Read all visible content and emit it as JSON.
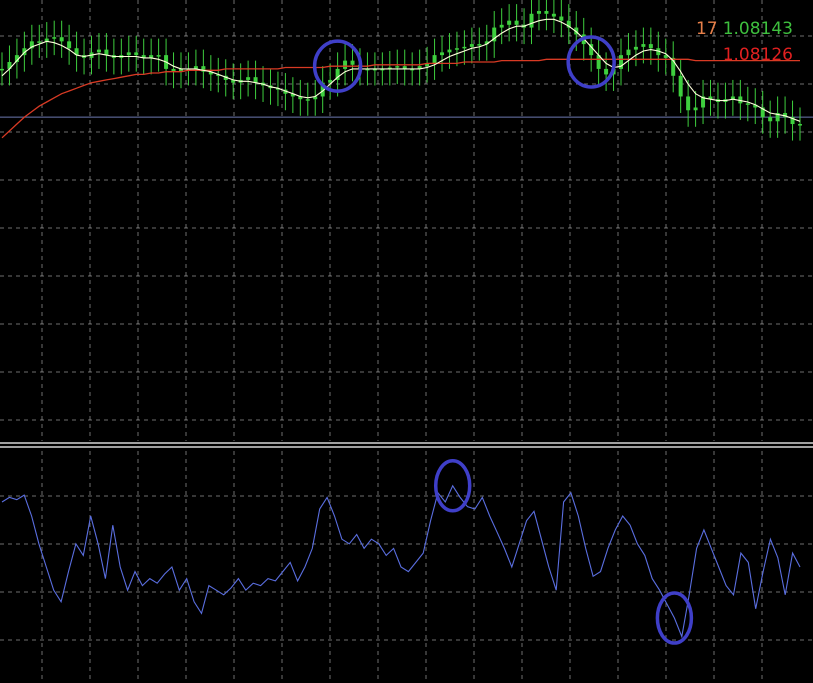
{
  "price_labels": {
    "period": "17",
    "fast_ma_value": "1.08143",
    "slow_ma_value": "1.08126"
  },
  "colors": {
    "background": "#000000",
    "grid": "#c8c8c8",
    "candle": "#3ecf3e",
    "fast_ma": "#ffffdc",
    "slow_ma": "#d83a24",
    "bid_line": "#6c78b0",
    "oscillator": "#5a6ee0",
    "highlight_circle": "#3f3fc8",
    "period_label": "#e8804a",
    "fast_label": "#3ec03e",
    "slow_label": "#e02020",
    "separator": "#ffffff"
  },
  "chart_data": [
    {
      "type": "line",
      "panel": "price",
      "grid": true,
      "series": [
        {
          "role": "candles",
          "values": [
            1.0812,
            1.08125,
            1.0813,
            1.08135,
            1.0814,
            1.0814,
            1.08142,
            1.08143,
            1.0814,
            1.08135,
            1.0813,
            1.08128,
            1.08132,
            1.08134,
            1.0813,
            1.08128,
            1.0813,
            1.08132,
            1.0813,
            1.08128,
            1.0813,
            1.0813,
            1.0812,
            1.08118,
            1.0812,
            1.0812,
            1.08122,
            1.08118,
            1.08116,
            1.08115,
            1.08112,
            1.0811,
            1.08112,
            1.08114,
            1.0811,
            1.08108,
            1.08106,
            1.08105,
            1.08102,
            1.081,
            1.08098,
            1.08098,
            1.081,
            1.0811,
            1.08112,
            1.0812,
            1.08126,
            1.08123,
            1.0812,
            1.0812,
            1.0812,
            1.0812,
            1.08121,
            1.08122,
            1.0812,
            1.0812,
            1.08122,
            1.08124,
            1.0813,
            1.08132,
            1.08134,
            1.08135,
            1.08136,
            1.08138,
            1.08138,
            1.0814,
            1.0815,
            1.08152,
            1.08155,
            1.08152,
            1.0815,
            1.0816,
            1.08162,
            1.0816,
            1.08158,
            1.08155,
            1.0815,
            1.08145,
            1.08138,
            1.0813,
            1.0812,
            1.08116,
            1.0812,
            1.0813,
            1.08134,
            1.08136,
            1.08138,
            1.08135,
            1.0813,
            1.08128,
            1.08115,
            1.081,
            1.0809,
            1.08092,
            1.081,
            1.08098,
            1.08096,
            1.08098,
            1.081,
            1.08095,
            1.08094,
            1.08092,
            1.08085,
            1.08082,
            1.08088,
            1.08085,
            1.0808,
            1.0808
          ]
        },
        {
          "role": "fast_ma",
          "values": [
            1.08115,
            1.0812,
            1.08126,
            1.08132,
            1.08136,
            1.08138,
            1.0814,
            1.08139,
            1.08137,
            1.08134,
            1.0813,
            1.08129,
            1.0813,
            1.08131,
            1.0813,
            1.08129,
            1.08129,
            1.08129,
            1.08129,
            1.08128,
            1.08128,
            1.08127,
            1.08125,
            1.08122,
            1.0812,
            1.0812,
            1.0812,
            1.08119,
            1.08118,
            1.08116,
            1.08114,
            1.08112,
            1.08111,
            1.08111,
            1.0811,
            1.08109,
            1.08107,
            1.08106,
            1.08104,
            1.08102,
            1.081,
            1.08099,
            1.081,
            1.08104,
            1.08109,
            1.08114,
            1.08118,
            1.0812,
            1.0812,
            1.0812,
            1.0812,
            1.0812,
            1.0812,
            1.0812,
            1.0812,
            1.0812,
            1.0812,
            1.08121,
            1.08123,
            1.08126,
            1.08129,
            1.08131,
            1.08133,
            1.08135,
            1.08136,
            1.08138,
            1.08142,
            1.08146,
            1.08149,
            1.08151,
            1.08151,
            1.08153,
            1.08155,
            1.08156,
            1.08156,
            1.08154,
            1.08151,
            1.08147,
            1.08142,
            1.08136,
            1.0813,
            1.08124,
            1.08121,
            1.08122,
            1.08126,
            1.0813,
            1.08133,
            1.08134,
            1.08133,
            1.08131,
            1.08126,
            1.08118,
            1.08109,
            1.08102,
            1.08099,
            1.08098,
            1.08097,
            1.08097,
            1.08098,
            1.08097,
            1.08096,
            1.08094,
            1.08091,
            1.08088,
            1.08087,
            1.08086,
            1.08084,
            1.08082
          ]
        },
        {
          "role": "slow_ma",
          "values": [
            1.0807,
            1.08075,
            1.0808,
            1.08085,
            1.08089,
            1.08093,
            1.08096,
            1.08099,
            1.08102,
            1.08104,
            1.08106,
            1.08108,
            1.0811,
            1.08111,
            1.08112,
            1.08113,
            1.08114,
            1.08115,
            1.08116,
            1.08116,
            1.08117,
            1.08117,
            1.08118,
            1.08118,
            1.08118,
            1.08119,
            1.08119,
            1.08119,
            1.08119,
            1.08119,
            1.0812,
            1.0812,
            1.0812,
            1.0812,
            1.0812,
            1.0812,
            1.0812,
            1.0812,
            1.08121,
            1.08121,
            1.08121,
            1.08121,
            1.08121,
            1.08121,
            1.08122,
            1.08122,
            1.08122,
            1.08122,
            1.08122,
            1.08122,
            1.08123,
            1.08123,
            1.08123,
            1.08123,
            1.08123,
            1.08123,
            1.08123,
            1.08124,
            1.08124,
            1.08124,
            1.08124,
            1.08124,
            1.08125,
            1.08125,
            1.08125,
            1.08125,
            1.08125,
            1.08126,
            1.08126,
            1.08126,
            1.08126,
            1.08126,
            1.08126,
            1.08127,
            1.08127,
            1.08127,
            1.08127,
            1.08127,
            1.08127,
            1.08127,
            1.08127,
            1.08127,
            1.08127,
            1.08127,
            1.08127,
            1.08127,
            1.08127,
            1.08127,
            1.08127,
            1.08127,
            1.08127,
            1.08127,
            1.08127,
            1.08126,
            1.08126,
            1.08126,
            1.08126,
            1.08126,
            1.08126,
            1.08126,
            1.08126,
            1.08126,
            1.08126,
            1.08126,
            1.08126,
            1.08126,
            1.08126,
            1.08126
          ]
        },
        {
          "role": "bid_line",
          "values": [
            1.08085
          ]
        }
      ],
      "ylim": [
        1.0785,
        1.0817
      ],
      "highlights": [
        {
          "index": 45,
          "value": 1.08122
        },
        {
          "index": 79,
          "value": 1.08125
        }
      ]
    },
    {
      "type": "line",
      "panel": "oscillator",
      "grid": true,
      "series": [
        {
          "role": "oscillator",
          "values": [
            78,
            80,
            79,
            81,
            72,
            60,
            50,
            40,
            35,
            48,
            60,
            55,
            72,
            60,
            45,
            68,
            50,
            40,
            48,
            42,
            45,
            43,
            47,
            50,
            40,
            45,
            35,
            30,
            42,
            40,
            38,
            41,
            45,
            40,
            43,
            42,
            45,
            44,
            48,
            52,
            44,
            50,
            58,
            75,
            80,
            72,
            62,
            60,
            64,
            58,
            62,
            60,
            55,
            58,
            50,
            48,
            52,
            56,
            70,
            82,
            78,
            85,
            80,
            76,
            75,
            80,
            72,
            65,
            58,
            50,
            60,
            70,
            74,
            62,
            50,
            40,
            78,
            82,
            72,
            58,
            46,
            48,
            58,
            66,
            72,
            68,
            60,
            55,
            45,
            40,
            34,
            28,
            20,
            38,
            58,
            66,
            58,
            50,
            42,
            38,
            56,
            52,
            32,
            48,
            62,
            54,
            38,
            56,
            50
          ]
        }
      ],
      "ylim": [
        0,
        100
      ],
      "highlights": [
        {
          "index": 61,
          "value": 85
        },
        {
          "index": 91,
          "value": 28
        }
      ]
    }
  ]
}
